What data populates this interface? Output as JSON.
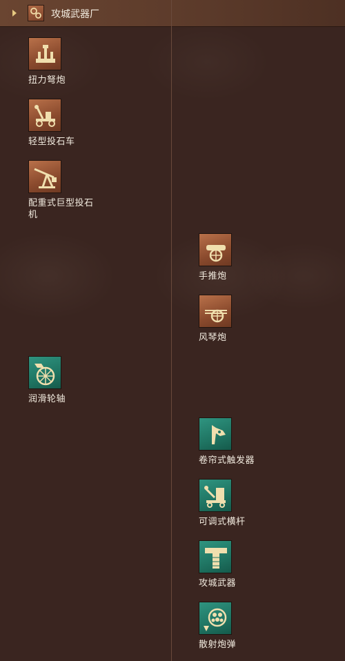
{
  "header": {
    "title": "攻城武器厂"
  },
  "nodes": [
    {
      "label": "扭力弩炮",
      "icon": "ballista-icon",
      "color": "brown"
    },
    {
      "label": "轻型投石车",
      "icon": "catapult-icon",
      "color": "brown"
    },
    {
      "label": "配重式巨型投石机",
      "icon": "trebuchet-icon",
      "color": "brown"
    },
    {
      "label": "手推炮",
      "icon": "cannon-icon",
      "color": "brown"
    },
    {
      "label": "风琴炮",
      "icon": "organ-gun-icon",
      "color": "brown"
    },
    {
      "label": "润滑轮轴",
      "icon": "wheel-axle-icon",
      "color": "teal"
    },
    {
      "label": "卷帘式触发器",
      "icon": "trigger-icon",
      "color": "teal"
    },
    {
      "label": "可调式横杆",
      "icon": "crossbar-icon",
      "color": "teal"
    },
    {
      "label": "攻城武器",
      "icon": "siege-weapon-icon",
      "color": "teal"
    },
    {
      "label": "散射炮弹",
      "icon": "scatter-shot-icon",
      "color": "teal"
    }
  ]
}
